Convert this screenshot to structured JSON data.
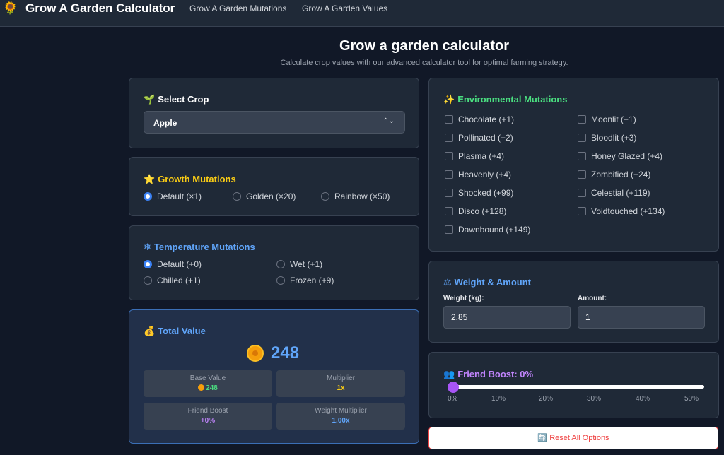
{
  "nav": {
    "logo_icon": "🌻",
    "brand": "Grow A Garden Calculator",
    "links": [
      "Grow A Garden Mutations",
      "Grow A Garden Values"
    ]
  },
  "header": {
    "title": "Grow a garden calculator",
    "subtitle": "Calculate crop values with our advanced calculator tool for optimal farming strategy."
  },
  "crop": {
    "icon": "🌱",
    "title": "Select Crop",
    "selected": "Apple",
    "chevron": "⌃⌄"
  },
  "growth": {
    "icon": "⭐",
    "title": "Growth Mutations",
    "options": [
      "Default (×1)",
      "Golden (×20)",
      "Rainbow (×50)"
    ]
  },
  "temperature": {
    "icon": "❄",
    "title": "Temperature Mutations",
    "options": [
      "Default (+0)",
      "Wet (+1)",
      "Chilled (+1)",
      "Frozen (+9)"
    ]
  },
  "total": {
    "icon": "💰",
    "title": "Total Value",
    "value": "248",
    "base_label": "Base Value",
    "base_value": "248",
    "multiplier_label": "Multiplier",
    "multiplier_value": "1x",
    "friend_label": "Friend Boost",
    "friend_value": "+0%",
    "weight_mult_label": "Weight Multiplier",
    "weight_mult_value": "1.00x"
  },
  "environmental": {
    "icon": "✨",
    "title": "Environmental Mutations",
    "left": [
      "Chocolate (+1)",
      "Pollinated (+2)",
      "Plasma (+4)",
      "Heavenly (+4)",
      "Shocked (+99)",
      "Disco (+128)",
      "Dawnbound (+149)"
    ],
    "right": [
      "Moonlit (+1)",
      "Bloodlit (+3)",
      "Honey Glazed (+4)",
      "Zombified (+24)",
      "Celestial (+119)",
      "Voidtouched (+134)"
    ]
  },
  "weight": {
    "icon": "⚖",
    "title": "Weight & Amount",
    "weight_label": "Weight (kg):",
    "weight_value": "2.85",
    "amount_label": "Amount:",
    "amount_value": "1"
  },
  "friend": {
    "icon": "👥",
    "title": "Friend Boost: 0%",
    "level_percent": 0,
    "ticks": [
      "0%",
      "10%",
      "20%",
      "30%",
      "40%",
      "50%"
    ]
  },
  "reset": {
    "icon": "🔄",
    "label": "Reset All Options"
  },
  "colors": {
    "accent_blue": "#60a5fa",
    "growth_yellow": "#facc15",
    "env_green": "#4ade80",
    "friend_purple": "#c084fc",
    "reset_red": "#ef4444"
  }
}
